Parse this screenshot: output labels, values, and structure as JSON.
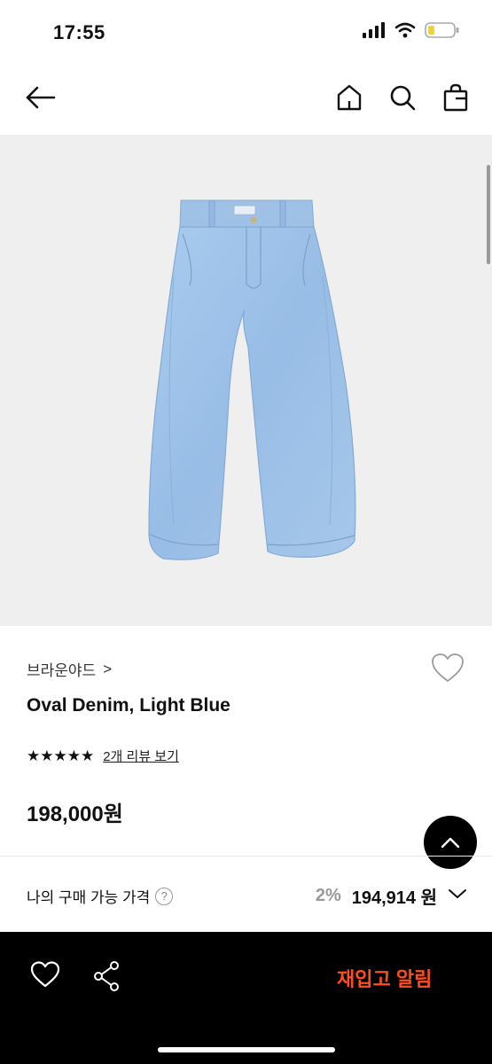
{
  "status_bar": {
    "time": "17:55"
  },
  "nav": {
    "back_icon": "arrow-left-icon",
    "home_icon": "home-icon",
    "search_icon": "search-icon",
    "bag_icon": "shopping-bag-icon"
  },
  "product": {
    "brand": "브라운야드",
    "brand_chevron": ">",
    "name": "Oval Denim, Light Blue",
    "stars": "★★★★★",
    "rating_stars": 5,
    "review_link": "2개 리뷰 보기",
    "price": "198,000원"
  },
  "my_price": {
    "label": "나의 구매 가능 가격",
    "info_icon": "?",
    "discount": "2%",
    "price": "194,914 원"
  },
  "bottom_bar": {
    "restock_label": "재입고 알림"
  },
  "colors": {
    "accent": "#ff4d1c",
    "bottom_bar": "#000000",
    "image_bg": "#efefef",
    "denim": "#9fc3ea"
  }
}
